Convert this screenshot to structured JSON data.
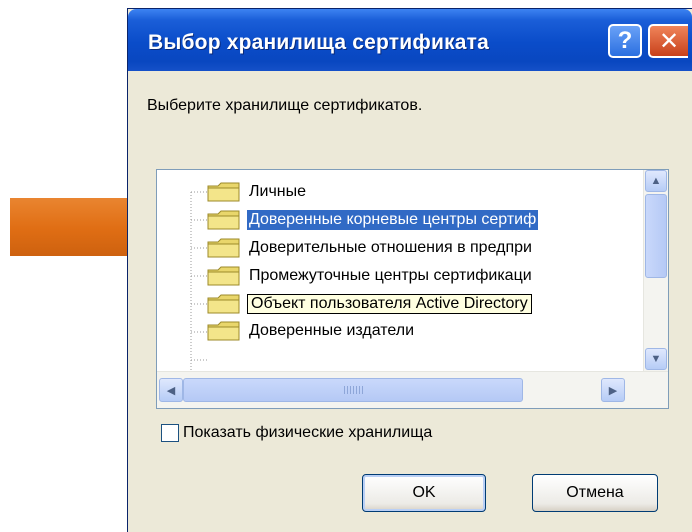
{
  "dialog": {
    "title": "Выбор хранилища сертификата",
    "help_glyph": "?",
    "close_glyph": "✕",
    "instruction": "Выберите хранилище сертификатов."
  },
  "tree": {
    "items": [
      {
        "label": "Личные",
        "state": "normal"
      },
      {
        "label": "Доверенные корневые центры сертиф",
        "state": "selected"
      },
      {
        "label": "Доверительные отношения в предпри",
        "state": "normal"
      },
      {
        "label": "Промежуточные центры сертификаци",
        "state": "normal"
      },
      {
        "label": "Объект пользователя Active Directory",
        "state": "tooltip"
      },
      {
        "label": "Доверенные издатели",
        "state": "normal"
      }
    ]
  },
  "checkbox": {
    "label": "Показать физические хранилища",
    "checked": false
  },
  "buttons": {
    "ok": "OK",
    "cancel": "Отмена"
  },
  "colors": {
    "arrow": "#e06e14",
    "title_bar": "#0a4cc9",
    "selection": "#316ac5",
    "tooltip_bg": "#ffffe1"
  }
}
